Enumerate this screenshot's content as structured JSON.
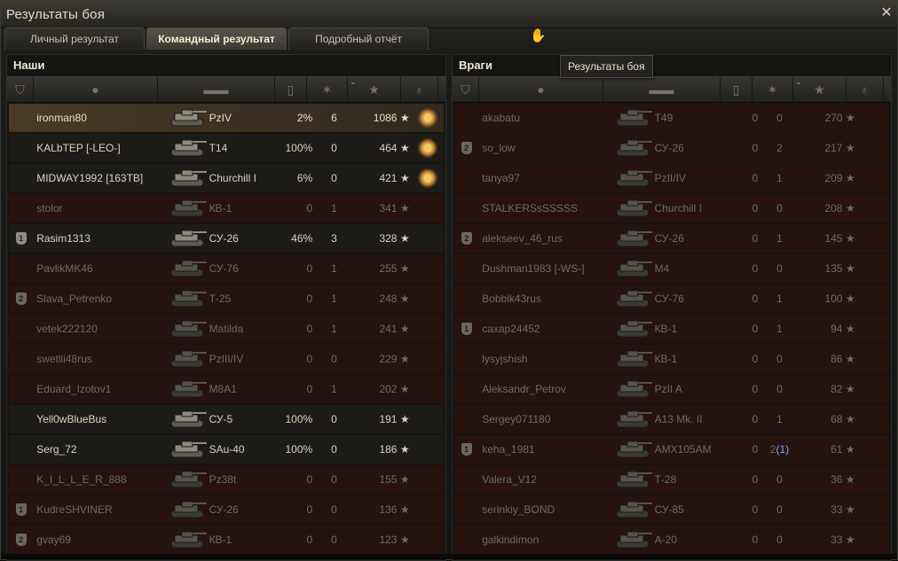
{
  "window": {
    "title": "Результаты боя",
    "close_icon": "close-icon"
  },
  "tabs": [
    {
      "label": "Личный результат",
      "active": false
    },
    {
      "label": "Командный результат",
      "active": true
    },
    {
      "label": "Подробный отчёт",
      "active": false
    }
  ],
  "tooltip": "Результаты боя",
  "cursor_icon": "hand-cursor-icon",
  "column_icons": [
    "shield-icon",
    "player-icon",
    "tank-icon",
    "damage-icon",
    "kills-icon",
    "xp-star-icon",
    "medal-icon"
  ],
  "ours": {
    "title": "Наши",
    "rows": [
      {
        "name": "ironman80",
        "tank": "PzIV",
        "dmg": "2%",
        "kills": "6",
        "xp": "1086",
        "badge": "",
        "status": "me",
        "medal": true
      },
      {
        "name": "KALbTEP [-LEO-]",
        "tank": "T14",
        "dmg": "100%",
        "kills": "0",
        "xp": "464",
        "badge": "",
        "status": "alive",
        "medal": true
      },
      {
        "name": "MIDWAY1992 [163TB]",
        "tank": "Churchill I",
        "dmg": "6%",
        "kills": "0",
        "xp": "421",
        "badge": "",
        "status": "alive",
        "medal": true
      },
      {
        "name": "stolor",
        "tank": "КВ-1",
        "dmg": "0",
        "kills": "1",
        "xp": "341",
        "badge": "",
        "status": "dead",
        "medal": false
      },
      {
        "name": "Rasim1313",
        "tank": "СУ-26",
        "dmg": "46%",
        "kills": "3",
        "xp": "328",
        "badge": "1",
        "status": "alive",
        "medal": false
      },
      {
        "name": "PavlikMK46",
        "tank": "СУ-76",
        "dmg": "0",
        "kills": "1",
        "xp": "255",
        "badge": "",
        "status": "dead",
        "medal": false
      },
      {
        "name": "Slava_Petrenko",
        "tank": "Т-25",
        "dmg": "0",
        "kills": "1",
        "xp": "248",
        "badge": "2",
        "status": "dead",
        "medal": false
      },
      {
        "name": "vetek222120",
        "tank": "Matilda",
        "dmg": "0",
        "kills": "1",
        "xp": "241",
        "badge": "",
        "status": "dead",
        "medal": false
      },
      {
        "name": "swetlii48rus",
        "tank": "PzIII/IV",
        "dmg": "0",
        "kills": "0",
        "xp": "229",
        "badge": "",
        "status": "dead",
        "medal": false
      },
      {
        "name": "Eduard_Izotov1",
        "tank": "M8A1",
        "dmg": "0",
        "kills": "1",
        "xp": "202",
        "badge": "",
        "status": "dead",
        "medal": false
      },
      {
        "name": "Yell0wBlueBus",
        "tank": "СУ-5",
        "dmg": "100%",
        "kills": "0",
        "xp": "191",
        "badge": "",
        "status": "alive",
        "medal": false
      },
      {
        "name": "Serg_72",
        "tank": "SAu-40",
        "dmg": "100%",
        "kills": "0",
        "xp": "186",
        "badge": "",
        "status": "alive",
        "medal": false
      },
      {
        "name": "K_I_L_L_E_R_888",
        "tank": "Pz38t",
        "dmg": "0",
        "kills": "0",
        "xp": "155",
        "badge": "",
        "status": "dead",
        "medal": false
      },
      {
        "name": "KudreSHVINER",
        "tank": "СУ-26",
        "dmg": "0",
        "kills": "0",
        "xp": "136",
        "badge": "1",
        "status": "dead",
        "medal": false
      },
      {
        "name": "gvay69",
        "tank": "КВ-1",
        "dmg": "0",
        "kills": "0",
        "xp": "123",
        "badge": "2",
        "status": "dead",
        "medal": false
      }
    ]
  },
  "enemies": {
    "title": "Враги",
    "rows": [
      {
        "name": "akabatu",
        "tank": "T49",
        "dmg": "0",
        "kills": "0",
        "xp": "270",
        "badge": "",
        "status": "dead"
      },
      {
        "name": "so_low",
        "tank": "СУ-26",
        "dmg": "0",
        "kills": "2",
        "xp": "217",
        "badge": "2",
        "status": "dead"
      },
      {
        "name": "tanya97",
        "tank": "PzII/IV",
        "dmg": "0",
        "kills": "1",
        "xp": "209",
        "badge": "",
        "status": "dead"
      },
      {
        "name": "STALKERSsSSSSS",
        "tank": "Churchill I",
        "dmg": "0",
        "kills": "0",
        "xp": "208",
        "badge": "",
        "status": "dead"
      },
      {
        "name": "alekseev_46_rus",
        "tank": "СУ-26",
        "dmg": "0",
        "kills": "1",
        "xp": "145",
        "badge": "2",
        "status": "dead"
      },
      {
        "name": "Dushman1983 [-WS-]",
        "tank": "M4",
        "dmg": "0",
        "kills": "0",
        "xp": "135",
        "badge": "",
        "status": "dead"
      },
      {
        "name": "Bobbik43rus",
        "tank": "СУ-76",
        "dmg": "0",
        "kills": "1",
        "xp": "100",
        "badge": "",
        "status": "dead"
      },
      {
        "name": "caxap24452",
        "tank": "КВ-1",
        "dmg": "0",
        "kills": "1",
        "xp": "94",
        "badge": "1",
        "status": "dead"
      },
      {
        "name": "lysyjshish",
        "tank": "КВ-1",
        "dmg": "0",
        "kills": "0",
        "xp": "86",
        "badge": "",
        "status": "dead"
      },
      {
        "name": "Aleksandr_Petrov",
        "tank": "PzII A",
        "dmg": "0",
        "kills": "0",
        "xp": "82",
        "badge": "",
        "status": "dead"
      },
      {
        "name": "Sergey071180",
        "tank": "A13 Mk. II",
        "dmg": "0",
        "kills": "1",
        "xp": "68",
        "badge": "",
        "status": "dead"
      },
      {
        "name": "keha_1981",
        "tank": "AMX105AM",
        "dmg": "0",
        "kills": "2",
        "kills_extra": "(1)",
        "xp": "61",
        "badge": "1",
        "status": "dead"
      },
      {
        "name": "Valera_V12",
        "tank": "Т-28",
        "dmg": "0",
        "kills": "0",
        "xp": "36",
        "badge": "",
        "status": "dead"
      },
      {
        "name": "serinkiy_BOND",
        "tank": "СУ-85",
        "dmg": "0",
        "kills": "0",
        "xp": "33",
        "badge": "",
        "status": "dead"
      },
      {
        "name": "galkindimon",
        "tank": "А-20",
        "dmg": "0",
        "kills": "0",
        "xp": "33",
        "badge": "",
        "status": "dead"
      }
    ]
  },
  "colors": {
    "dead_row": "#26120f",
    "alive_row": "#1c1b18",
    "my_row": "#4a3a25",
    "assist": "#7fb0ff"
  }
}
